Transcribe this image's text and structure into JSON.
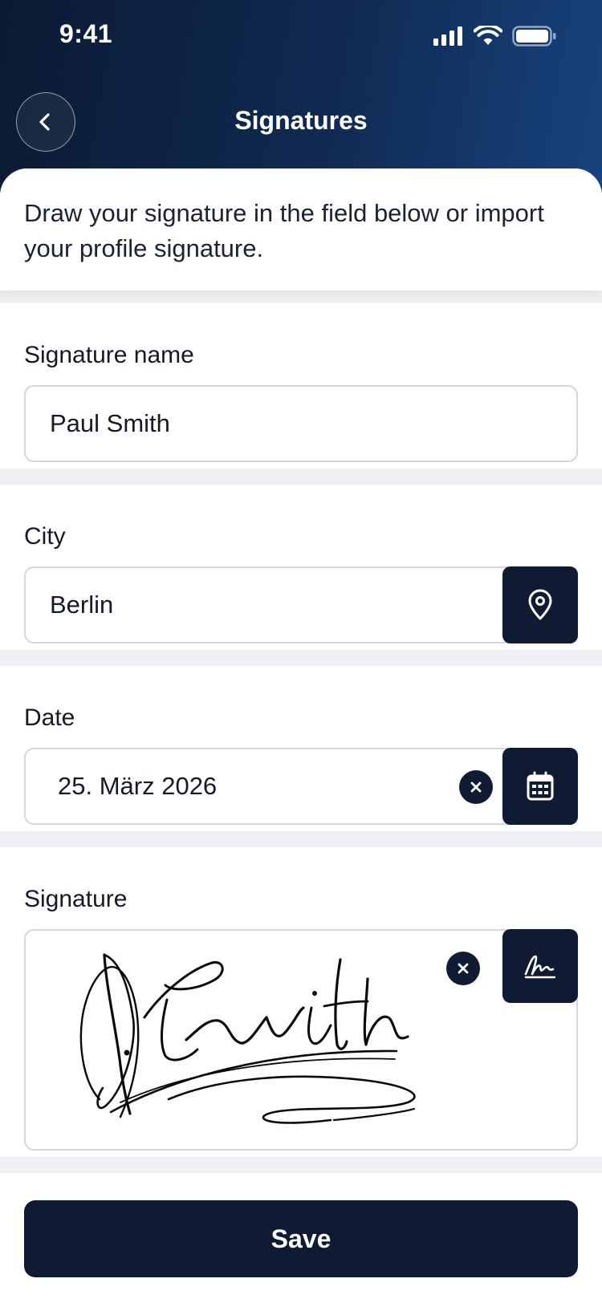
{
  "status_bar": {
    "time": "9:41"
  },
  "nav": {
    "title": "Signatures"
  },
  "intro": {
    "text": "Draw your signature in the field below or import your profile signature."
  },
  "fields": {
    "signature_name": {
      "label": "Signature name",
      "value": "Paul Smith"
    },
    "city": {
      "label": "City",
      "value": "Berlin"
    },
    "date": {
      "label": "Date",
      "value": "25. März 2026"
    },
    "signature": {
      "label": "Signature"
    }
  },
  "footer": {
    "save_label": "Save"
  },
  "icons": {
    "back": "chevron-left-icon",
    "location": "location-pin-icon",
    "calendar": "calendar-icon",
    "sign": "signature-icon",
    "clear": "close-icon"
  },
  "colors": {
    "header_start": "#0b1a33",
    "header_end": "#17437e",
    "primary": "#0e1b33",
    "background": "#eef0f4"
  }
}
